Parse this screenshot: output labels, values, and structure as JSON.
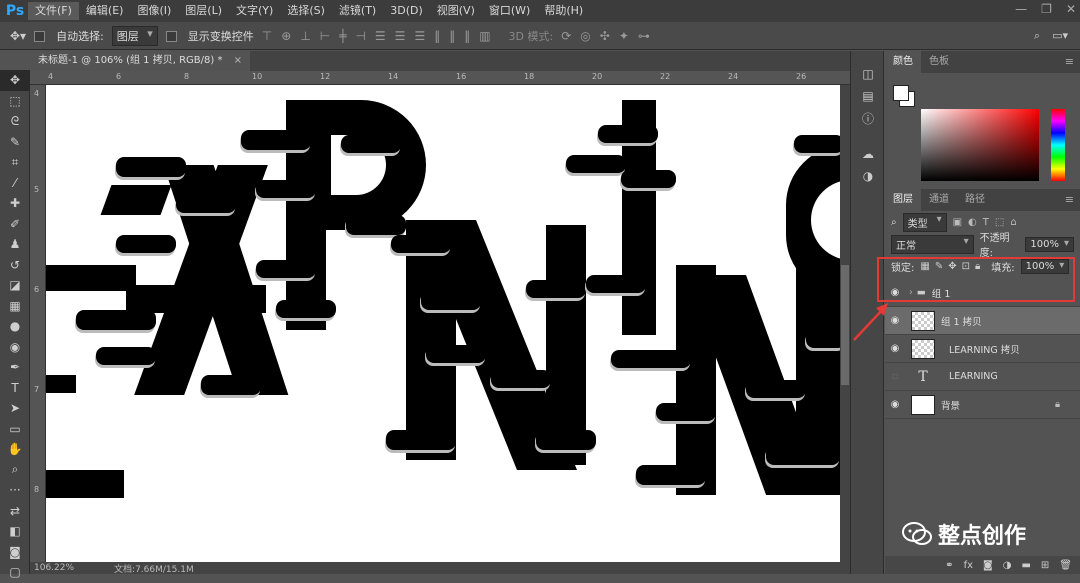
{
  "app": {
    "logo": "Ps"
  },
  "menu": [
    "文件(F)",
    "编辑(E)",
    "图像(I)",
    "图层(L)",
    "文字(Y)",
    "选择(S)",
    "滤镜(T)",
    "3D(D)",
    "视图(V)",
    "窗口(W)",
    "帮助(H)"
  ],
  "window": {
    "minimize": "—",
    "restore": "❐",
    "close": "✕"
  },
  "options": {
    "auto_select_label": "自动选择:",
    "auto_select_value": "图层",
    "show_transform_label": "显示变换控件",
    "mode_3d_label": "3D 模式:"
  },
  "document": {
    "tab_title": "未标题-1 @ 106% (组 1 拷贝, RGB/8) *",
    "tab_close": "×"
  },
  "ruler": {
    "top_ticks": [
      "4",
      "6",
      "8",
      "10",
      "12",
      "14",
      "16",
      "18",
      "20",
      "22",
      "24",
      "26"
    ],
    "left_ticks": [
      "4",
      "5",
      "6",
      "7",
      "8"
    ]
  },
  "status": {
    "zoom": "106.22%",
    "doc_info": "文档:7.66M/15.1M"
  },
  "color_panel": {
    "tabs": [
      "颜色",
      "色板"
    ]
  },
  "layers_panel": {
    "tabs": [
      "图层",
      "通道",
      "路径"
    ],
    "filter_kind": "类型",
    "blend_mode": "正常",
    "opacity_label": "不透明度:",
    "opacity_value": "100%",
    "lock_label": "锁定:",
    "fill_label": "填充:",
    "fill_value": "100%",
    "layers": [
      {
        "name": "组 1",
        "type": "group",
        "visible": true,
        "selected": false
      },
      {
        "name": "组 1 拷贝",
        "type": "pixel",
        "visible": true,
        "selected": true
      },
      {
        "name": "LEARNING 拷贝",
        "type": "pixel",
        "visible": true,
        "selected": false
      },
      {
        "name": "LEARNING",
        "type": "text",
        "visible": false,
        "selected": false
      },
      {
        "name": "背景",
        "type": "background",
        "visible": true,
        "selected": false,
        "locked": true
      }
    ]
  },
  "watermark": {
    "text": "整点创作"
  },
  "colors": {
    "highlight": "#e53935",
    "accent": "#31a8ff"
  }
}
